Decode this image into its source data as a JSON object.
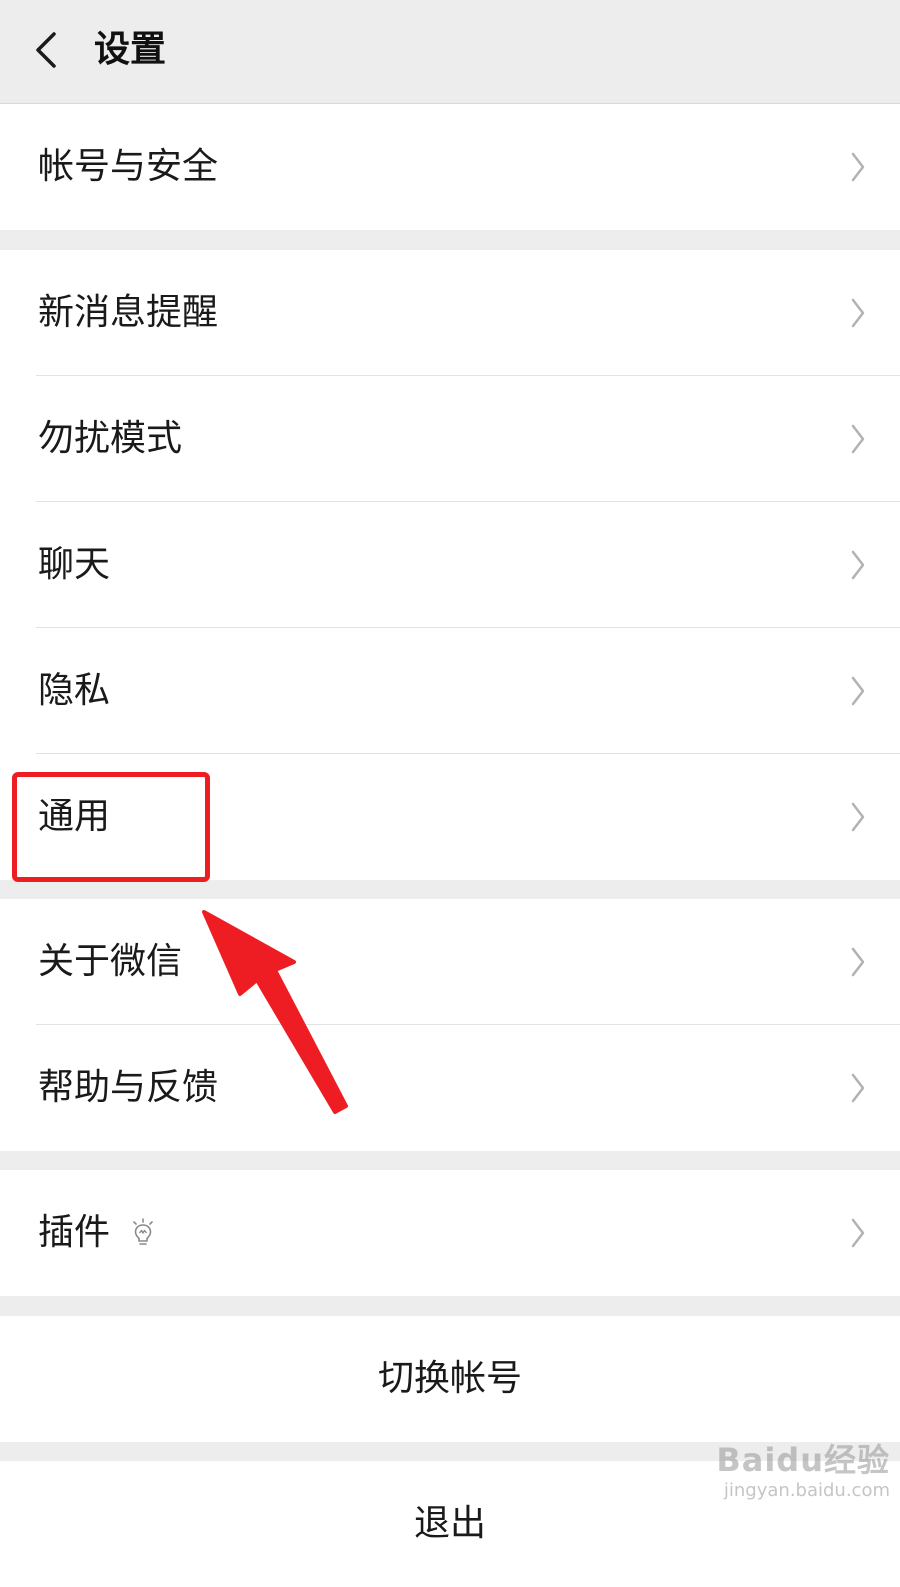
{
  "header": {
    "title": "设置"
  },
  "sections": [
    {
      "items": [
        {
          "label": "帐号与安全"
        }
      ]
    },
    {
      "items": [
        {
          "label": "新消息提醒"
        },
        {
          "label": "勿扰模式"
        },
        {
          "label": "聊天"
        },
        {
          "label": "隐私"
        },
        {
          "label": "通用"
        }
      ]
    },
    {
      "items": [
        {
          "label": "关于微信"
        },
        {
          "label": "帮助与反馈"
        }
      ]
    },
    {
      "items": [
        {
          "label": "插件",
          "icon": "bulb-icon"
        }
      ]
    }
  ],
  "actions": {
    "switch_account": "切换帐号",
    "logout": "退出"
  },
  "annotation": {
    "highlight_target": "通用",
    "color": "#ee1d23"
  },
  "watermark": {
    "logo": "Baidu经验",
    "url": "jingyan.baidu.com"
  },
  "colors": {
    "background": "#ededed",
    "card": "#ffffff",
    "text": "#1a1a1a",
    "chevron": "#b2b2b2"
  }
}
